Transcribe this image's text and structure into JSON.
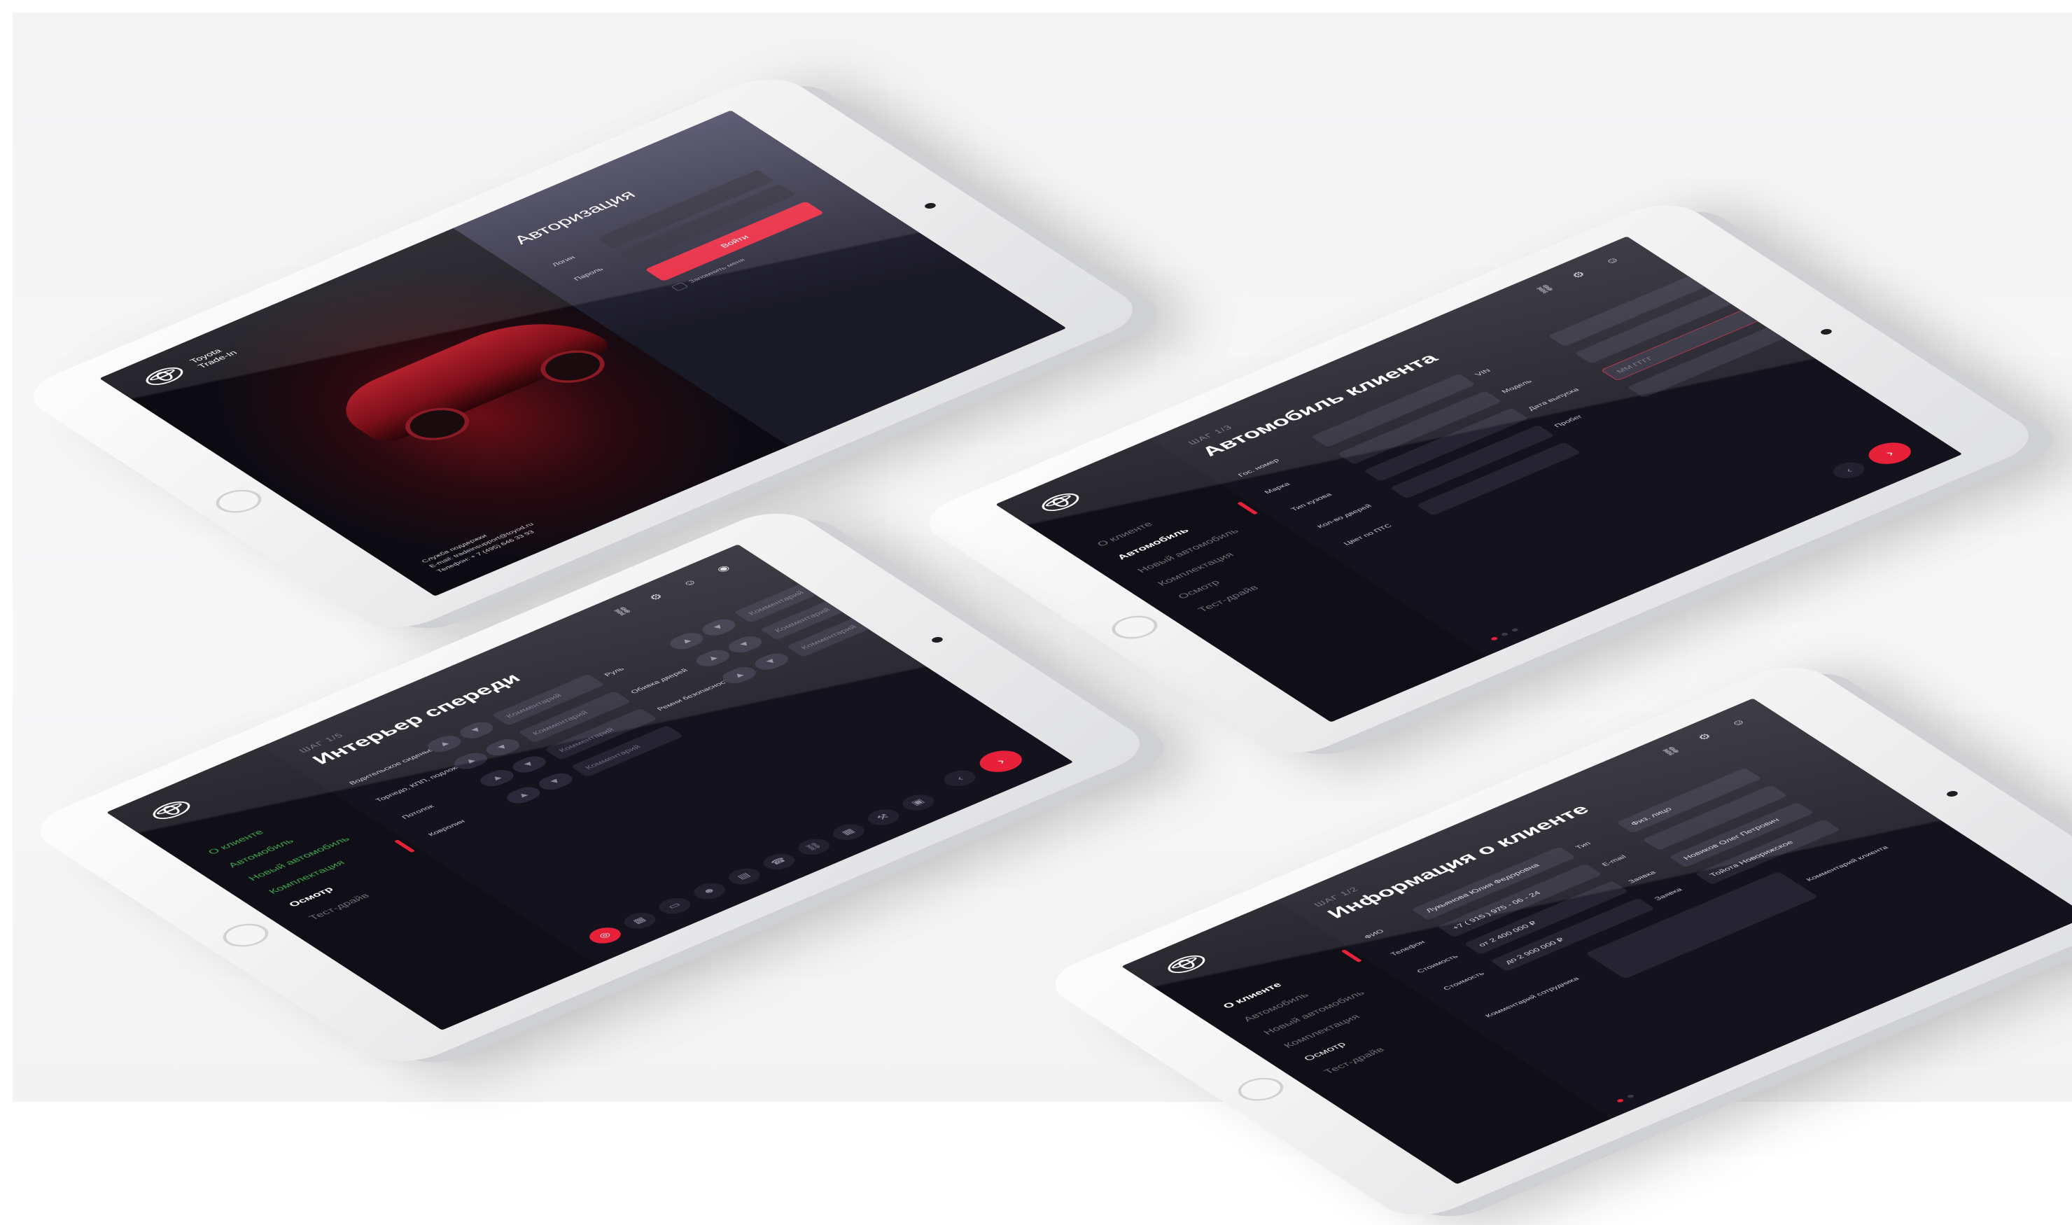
{
  "colors": {
    "accent": "#e8213a",
    "screen_bg": "#14131d",
    "success": "#3fa44d"
  },
  "login": {
    "brand": "Toyota\nTrade-In",
    "title": "Авторизация",
    "login_label": "Логин",
    "password_label": "Пароль",
    "submit": "Войти",
    "remember": "Запомнить меня",
    "support_line1": "Служба поддержки",
    "support_line2": "E-mail: tradeinsupport@toyod.ru",
    "support_line3": "Телефон: + 7 (495) 646 33 93"
  },
  "car_client": {
    "menu": [
      "О клиенте",
      "Автомобиль",
      "Новый автомобиль",
      "Комплектация",
      "Осмотр",
      "Тест-драйв"
    ],
    "step": "ШАГ 1/3",
    "title": "Автомобиль клиента",
    "labels": [
      "Гос. номер",
      "VIN",
      "Марка",
      "Модель",
      "Тип кузова",
      "Кол-во дверей",
      "Цвет по ПТС",
      "Дата выпуска",
      "Пробег"
    ],
    "date_placeholder": "ММ    ГГГГ",
    "toolbar_icons": [
      "car-icon",
      "gear-icon",
      "user-icon"
    ]
  },
  "interior": {
    "menu": [
      "О клиенте",
      "Автомобиль",
      "Новый автомобиль",
      "Комплектация",
      "Осмотр",
      "Тест-драйв"
    ],
    "step": "ШАГ 1/5",
    "title": "Интерьер спереди",
    "rows": [
      "Водительское сиденье",
      "Торпедо, КПП, подлокотники",
      "Потолок",
      "Ковролин",
      "Руль",
      "Обивка дверей",
      "Ремни безопасности"
    ],
    "comment_placeholder": "Комментарий"
  },
  "client_info": {
    "menu": [
      "О клиенте",
      "Автомобиль",
      "Новый автомобиль",
      "Комплектация",
      "Осмотр",
      "Тест-драйв"
    ],
    "step": "ШАГ 1/2",
    "title": "Информация о клиенте",
    "fields": [
      {
        "label": "ФИО",
        "value": "Лукьянова Юлия Федоровна"
      },
      {
        "label": "Телефон",
        "value": "+7 ( 915 ) 975 - 06 - 24"
      },
      {
        "label": "Стоимость",
        "value": "от 2 400 000 ₽"
      },
      {
        "label": "Стоимость",
        "value": "до 2 900 000 ₽"
      },
      {
        "label": "Тип",
        "value": "Физ. лицо"
      },
      {
        "label": "Заявка",
        "value": "Новиков Олег Петрович"
      },
      {
        "label": "Заявка",
        "value": "Тойота Новорижское"
      }
    ],
    "extra_labels": [
      "E-mail",
      "Комментарий сотрудника",
      "Комментарий клиента"
    ]
  }
}
